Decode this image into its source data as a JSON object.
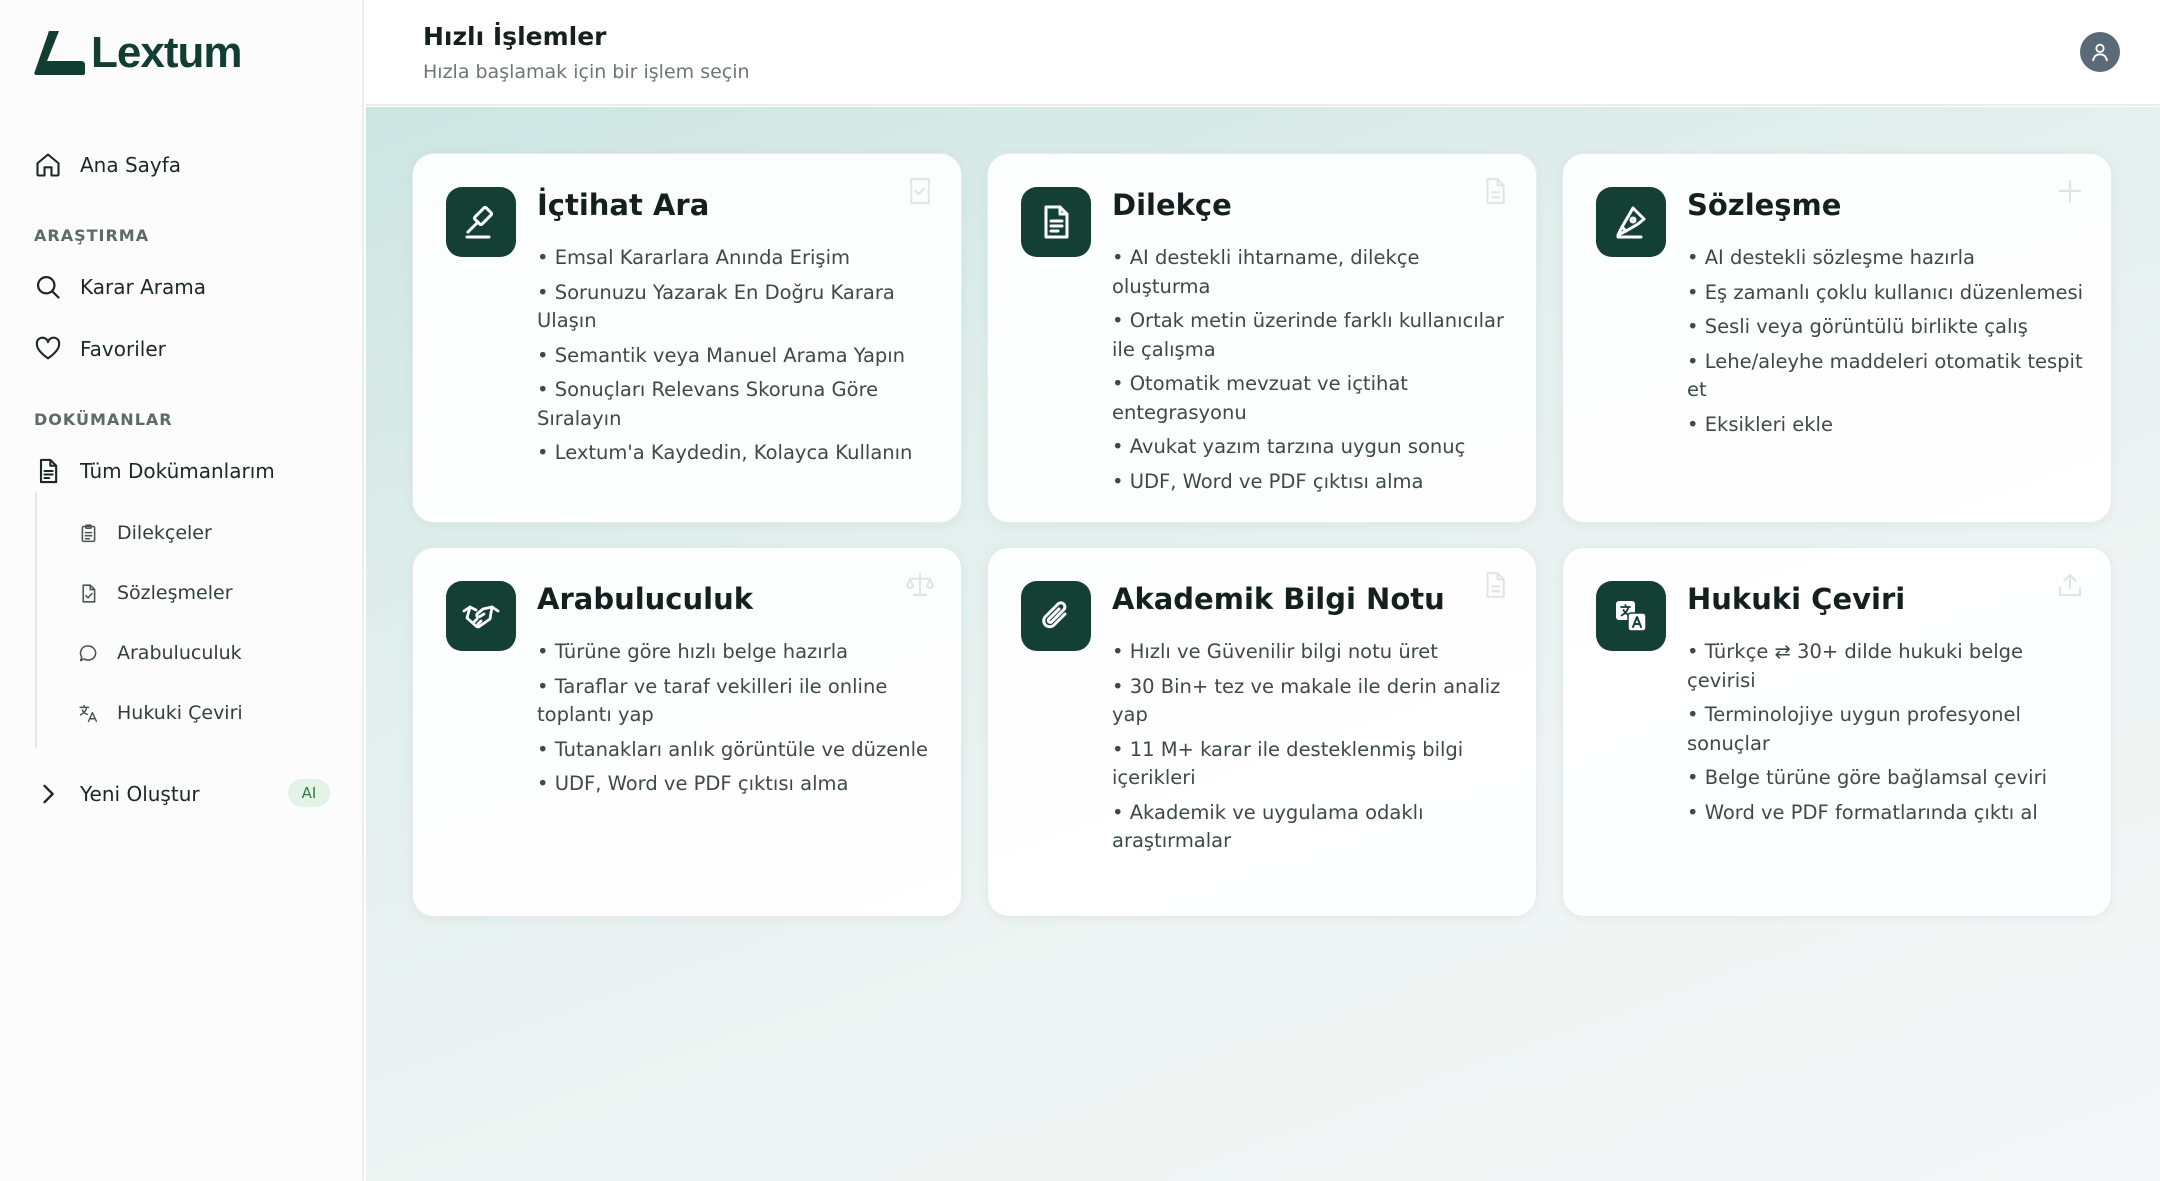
{
  "app": {
    "name": "Lextum"
  },
  "sidebar": {
    "home": "Ana Sayfa",
    "research_label": "ARAŞTIRMA",
    "research_items": [
      "Karar Arama",
      "Favoriler"
    ],
    "documents_label": "DOKÜMANLAR",
    "all_documents": "Tüm Dokümanlarım",
    "document_items": [
      "Dilekçeler",
      "Sözleşmeler",
      "Arabuluculuk",
      "Hukuki Çeviri"
    ],
    "create_new": "Yeni Oluştur",
    "ai_badge": "AI"
  },
  "header": {
    "title": "Hızlı İşlemler",
    "subtitle": "Hızla başlamak için bir işlem seçin"
  },
  "cards": [
    {
      "title": "İçtihat Ara",
      "icon": "gavel-icon",
      "items": [
        "• Emsal Kararlara Anında Erişim",
        "• Sorunuzu Yazarak En Doğru Karara Ulaşın",
        "• Semantik veya Manuel Arama Yapın",
        "• Sonuçları Relevans Skoruna Göre Sıralayın",
        "• Lextum'a Kaydedin, Kolayca Kullanın"
      ]
    },
    {
      "title": "Dilekçe",
      "icon": "document-icon",
      "items": [
        "• AI destekli ihtarname, dilekçe oluşturma",
        "• Ortak metin üzerinde farklı kullanıcılar ile çalışma",
        "• Otomatik mevzuat ve içtihat entegrasyonu",
        "• Avukat yazım tarzına uygun sonuç",
        "• UDF, Word ve PDF çıktısı alma"
      ]
    },
    {
      "title": "Sözleşme",
      "icon": "pen-nib-icon",
      "items": [
        "• AI destekli sözleşme hazırla",
        "• Eş zamanlı çoklu kullanıcı düzenlemesi",
        "• Sesli veya görüntülü birlikte çalış",
        "• Lehe/aleyhe maddeleri otomatik tespit et",
        "• Eksikleri ekle"
      ]
    },
    {
      "title": "Arabuluculuk",
      "icon": "handshake-icon",
      "items": [
        "• Türüne göre hızlı belge hazırla",
        "• Taraflar ve taraf vekilleri ile online toplantı yap",
        "• Tutanakları anlık görüntüle ve düzenle",
        "• UDF, Word ve PDF çıktısı alma"
      ]
    },
    {
      "title": "Akademik Bilgi Notu",
      "icon": "paperclip-icon",
      "items": [
        "• Hızlı ve Güvenilir bilgi notu üret",
        "• 30 Bin+ tez ve makale ile derin analiz yap",
        "• 11 M+ karar ile desteklenmiş bilgi içerikleri",
        "• Akademik ve uygulama odaklı araştırmalar"
      ]
    },
    {
      "title": "Hukuki Çeviri",
      "icon": "translate-icon",
      "items": [
        "• Türkçe ⇄ 30+ dilde hukuki belge çevirisi",
        "• Terminolojiye uygun profesyonel sonuçlar",
        "• Belge türüne göre bağlamsal çeviri",
        "• Word ve PDF formatlarında çıktı al"
      ]
    }
  ]
}
